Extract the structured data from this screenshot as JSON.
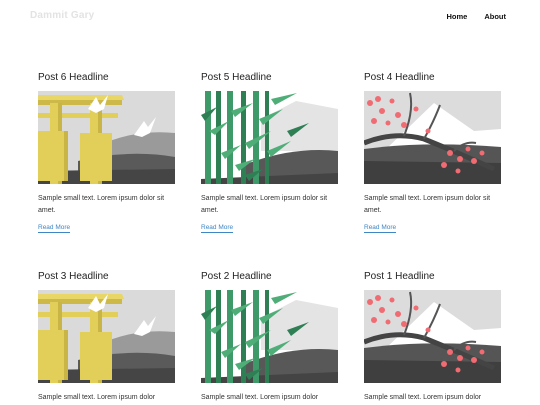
{
  "site": {
    "brand": "Dammit Gary"
  },
  "nav": [
    {
      "label": "Home"
    },
    {
      "label": "About"
    }
  ],
  "posts": [
    {
      "title": "Post 6 Headline",
      "excerpt": "Sample small text. Lorem ipsum dolor sit amet.",
      "link": "Read More",
      "image": "torii-gate-illustration"
    },
    {
      "title": "Post 5 Headline",
      "excerpt": "Sample small text. Lorem ipsum dolor sit amet.",
      "link": "Read More",
      "image": "bamboo-illustration"
    },
    {
      "title": "Post 4 Headline",
      "excerpt": "Sample small text. Lorem ipsum dolor sit amet.",
      "link": "Read More",
      "image": "cherry-blossom-mountain-illustration"
    },
    {
      "title": "Post 3 Headline",
      "excerpt": "Sample small text. Lorem ipsum dolor",
      "link": "",
      "image": "torii-gate-illustration"
    },
    {
      "title": "Post 2 Headline",
      "excerpt": "Sample small text. Lorem ipsum dolor",
      "link": "",
      "image": "bamboo-illustration"
    },
    {
      "title": "Post 1 Headline",
      "excerpt": "Sample small text. Lorem ipsum dolor",
      "link": "",
      "image": "cherry-blossom-mountain-illustration"
    }
  ],
  "colors": {
    "link": "#3f86c4",
    "torii": "#e2cf5a",
    "bamboo": "#3f9a6a",
    "blossom": "#f06b72"
  }
}
